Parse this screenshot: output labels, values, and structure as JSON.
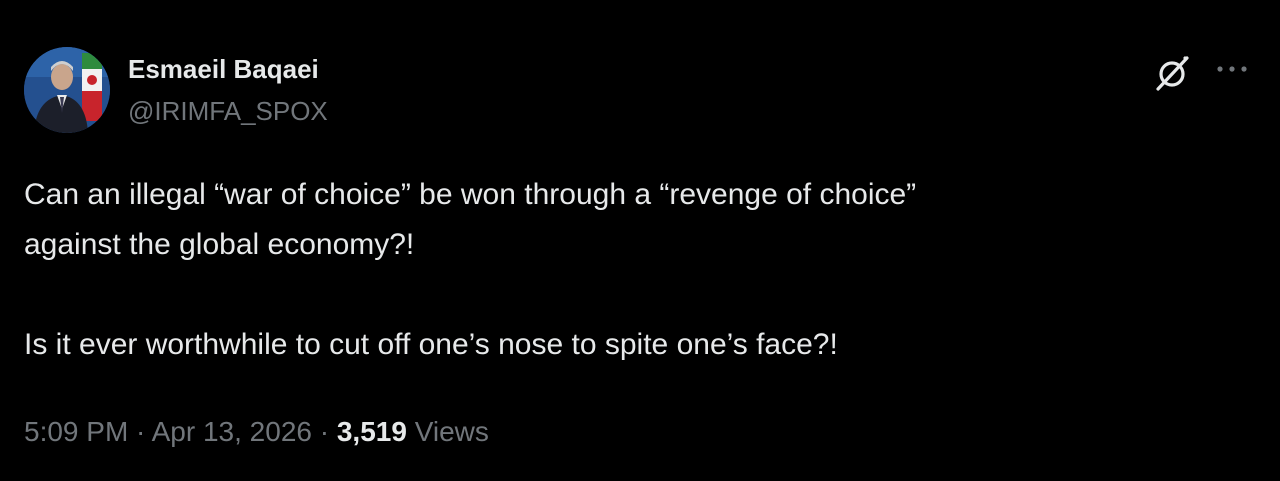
{
  "author": {
    "display_name": "Esmaeil Baqaei",
    "handle": "@IRIMFA_SPOX"
  },
  "tweet": {
    "lines": [
      "Can an illegal “war of choice” be won through a “revenge of choice”",
      "against the global economy?!",
      "Is it ever worthwhile to cut off one’s nose to spite one’s face?!"
    ]
  },
  "meta": {
    "time": "5:09 PM",
    "separator": " · ",
    "date": "Apr 13, 2026",
    "views_count": "3,519",
    "views_label": "Views"
  },
  "icons": {
    "grok": "grok-icon",
    "more": "more-icon"
  },
  "colors": {
    "background": "#000000",
    "primary_text": "#e7e9ea",
    "secondary_text": "#71767b"
  }
}
